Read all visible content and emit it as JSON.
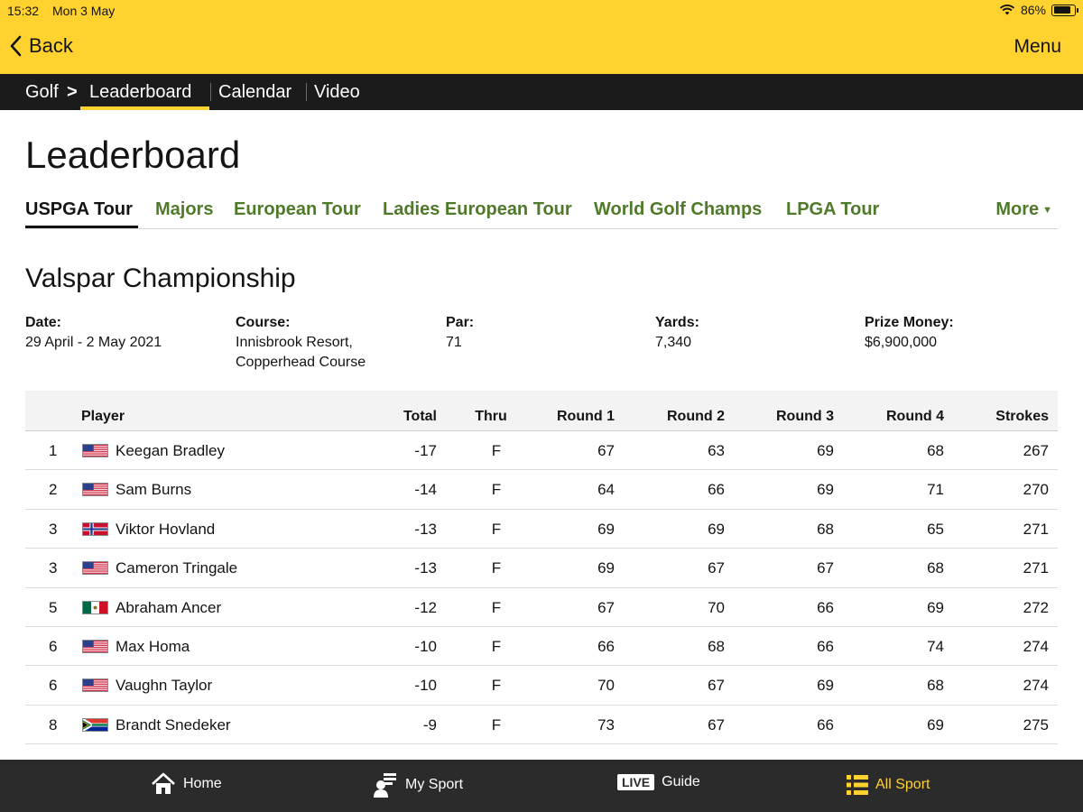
{
  "status": {
    "time": "15:32",
    "date": "Mon 3 May",
    "battery": "86%"
  },
  "header": {
    "back_label": "Back",
    "menu_label": "Menu"
  },
  "nav": {
    "golf": "Golf",
    "chevron": ">",
    "leaderboard": "Leaderboard",
    "calendar": "Calendar",
    "video": "Video"
  },
  "page": {
    "title": "Leaderboard"
  },
  "tabs": {
    "items": [
      "USPGA Tour",
      "Majors",
      "European Tour",
      "Ladies European Tour",
      "World Golf Champs",
      "LPGA Tour"
    ],
    "more": "More",
    "active": "USPGA Tour"
  },
  "event": {
    "title": "Valspar Championship",
    "date_label": "Date:",
    "date": "29 April - 2 May 2021",
    "course_label": "Course:",
    "course_line1": "Innisbrook Resort,",
    "course_line2": "Copperhead Course",
    "par_label": "Par:",
    "par": "71",
    "yards_label": "Yards:",
    "yards": "7,340",
    "prize_label": "Prize Money:",
    "prize": "$6,900,000"
  },
  "table": {
    "headers": {
      "player": "Player",
      "total": "Total",
      "thru": "Thru",
      "r1": "Round 1",
      "r2": "Round 2",
      "r3": "Round 3",
      "r4": "Round 4",
      "strokes": "Strokes"
    },
    "rows": [
      {
        "pos": "1",
        "flag": "usa",
        "name": "Keegan Bradley",
        "total": "-17",
        "thru": "F",
        "r1": "67",
        "r2": "63",
        "r3": "69",
        "r4": "68",
        "strokes": "267"
      },
      {
        "pos": "2",
        "flag": "usa",
        "name": "Sam Burns",
        "total": "-14",
        "thru": "F",
        "r1": "64",
        "r2": "66",
        "r3": "69",
        "r4": "71",
        "strokes": "270"
      },
      {
        "pos": "3",
        "flag": "norway",
        "name": "Viktor Hovland",
        "total": "-13",
        "thru": "F",
        "r1": "69",
        "r2": "69",
        "r3": "68",
        "r4": "65",
        "strokes": "271"
      },
      {
        "pos": "3",
        "flag": "usa",
        "name": "Cameron Tringale",
        "total": "-13",
        "thru": "F",
        "r1": "69",
        "r2": "67",
        "r3": "67",
        "r4": "68",
        "strokes": "271"
      },
      {
        "pos": "5",
        "flag": "mexico",
        "name": "Abraham Ancer",
        "total": "-12",
        "thru": "F",
        "r1": "67",
        "r2": "70",
        "r3": "66",
        "r4": "69",
        "strokes": "272"
      },
      {
        "pos": "6",
        "flag": "usa",
        "name": "Max Homa",
        "total": "-10",
        "thru": "F",
        "r1": "66",
        "r2": "68",
        "r3": "66",
        "r4": "74",
        "strokes": "274"
      },
      {
        "pos": "6",
        "flag": "usa",
        "name": "Vaughn Taylor",
        "total": "-10",
        "thru": "F",
        "r1": "70",
        "r2": "67",
        "r3": "69",
        "r4": "68",
        "strokes": "274"
      },
      {
        "pos": "8",
        "flag": "south-africa",
        "name": "Brandt Snedeker",
        "total": "-9",
        "thru": "F",
        "r1": "73",
        "r2": "67",
        "r3": "66",
        "r4": "69",
        "strokes": "275"
      }
    ]
  },
  "bottom_nav": {
    "home": "Home",
    "my_sport": "My Sport",
    "live_badge": "LIVE",
    "guide": "Guide",
    "all_sport": "All Sport"
  },
  "colors": {
    "accent": "#ffd230",
    "tab_green": "#4e7a2a",
    "nav_dark": "#1b1b1b",
    "bottom_bar": "#2b2b2b"
  },
  "icons": [
    "back-chevron-icon",
    "wifi-icon",
    "battery-icon",
    "home-icon",
    "my-sport-icon",
    "all-sport-icon",
    "usa-flag-icon",
    "norway-flag-icon",
    "mexico-flag-icon",
    "south-africa-flag-icon"
  ]
}
